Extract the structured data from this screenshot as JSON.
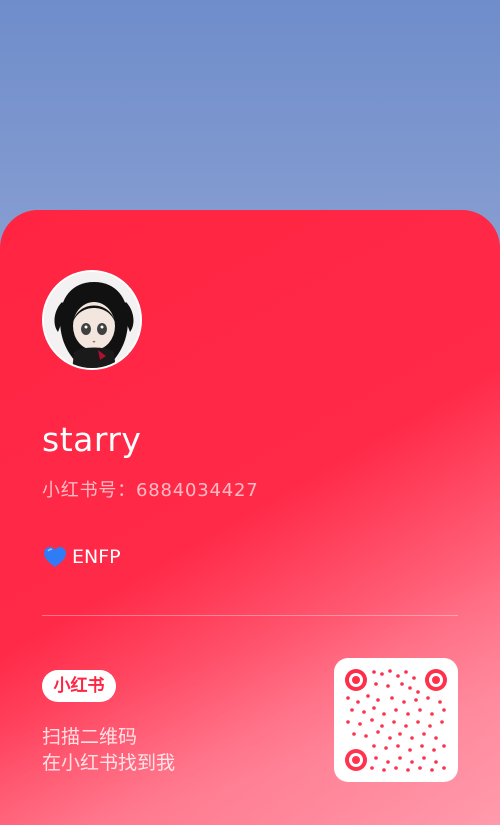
{
  "profile": {
    "name": "starry",
    "account_label": "小红书号：6884034427",
    "mbti_text": "ENFP"
  },
  "footer": {
    "brand": "小红书",
    "scan_line_1": "扫描二维码",
    "scan_line_2": "在小红书找到我"
  },
  "colors": {
    "accent": "#ff2442",
    "heart": "#2f7cf6"
  },
  "icons": {
    "mbti_prefix": "blue-heart-icon",
    "qr": "qr-code-icon"
  }
}
